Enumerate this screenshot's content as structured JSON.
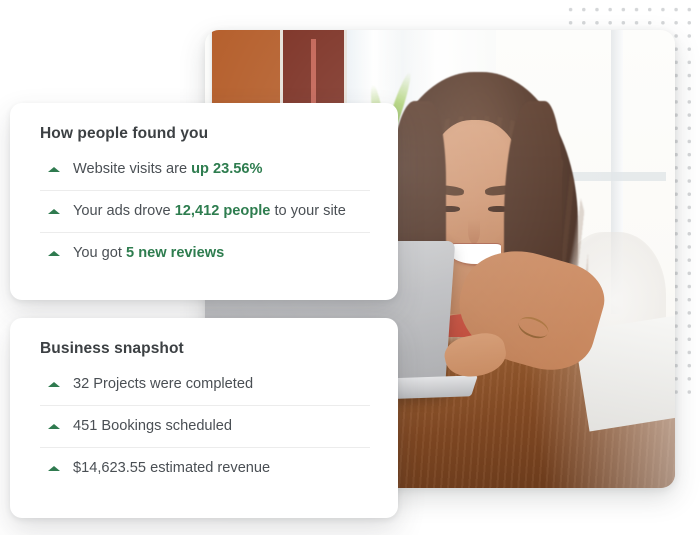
{
  "decor": {
    "dot_grid": "dot-grid-pattern",
    "dot_color": "#d4d6d8"
  },
  "photo": {
    "alt": "Smiling woman with long brown hair in a red top working on a silver laptop at a wooden desk near a bright window with plants",
    "subject": "woman-at-laptop",
    "accent_colors": {
      "top": "#b23c2d",
      "hair": "#54382a",
      "desk": "#8d5127",
      "laptop": "#bcbdc0",
      "plant": "#74a83f"
    }
  },
  "cards": [
    {
      "id": "how-people-found-you",
      "title": "How people found you",
      "rows": [
        {
          "icon": "caret-up-icon",
          "prefix": "Website visits are ",
          "highlight": "up 23.56%",
          "suffix": ""
        },
        {
          "icon": "caret-up-icon",
          "prefix": "Your ads drove ",
          "highlight": "12,412 people",
          "suffix": " to your site"
        },
        {
          "icon": "caret-up-icon",
          "prefix": "You got ",
          "highlight": "5 new reviews",
          "suffix": ""
        }
      ]
    },
    {
      "id": "business-snapshot",
      "title": "Business snapshot",
      "rows": [
        {
          "icon": "caret-up-icon",
          "prefix": "32 Projects were completed",
          "highlight": "",
          "suffix": ""
        },
        {
          "icon": "caret-up-icon",
          "prefix": "451 Bookings scheduled",
          "highlight": "",
          "suffix": ""
        },
        {
          "icon": "caret-up-icon",
          "prefix": "$14,623.55 estimated revenue",
          "highlight": "",
          "suffix": ""
        }
      ]
    }
  ],
  "theme": {
    "accent_green": "#2e7d4f",
    "title_color": "#3c4043",
    "body_color": "#4a4f54",
    "divider_color": "#ececec",
    "card_background": "#ffffff"
  }
}
